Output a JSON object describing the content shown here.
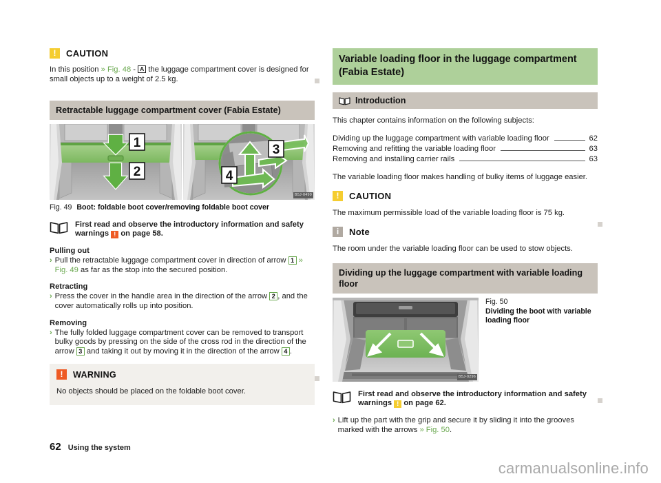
{
  "page": {
    "number": "62",
    "footer_section": "Using the system",
    "watermark": "carmanualsonline.info"
  },
  "left_column": {
    "caution_1": {
      "icon": "caution-icon",
      "title": "CAUTION",
      "text_part1": "In this position ",
      "link": "» Fig. 48",
      "text_part2": " - ",
      "ref": "A",
      "text_part3": " the luggage compartment cover is designed for small objects up to a weight of 2.5 kg."
    },
    "section_heading": "Retractable luggage compartment cover (Fabia Estate)",
    "figure": {
      "number": "Fig. 49",
      "caption": "Boot: foldable boot cover/removing foldable boot cover",
      "code": "B5J-0499",
      "callouts": [
        "1",
        "2",
        "3",
        "4"
      ]
    },
    "intro_note": {
      "icon": "book-icon",
      "text_part1": "First read and observe the introductory information and safety warnings ",
      "inline_icon": "!",
      "text_part2": " on page 58."
    },
    "pulling_out": {
      "heading": "Pulling out",
      "bullet_part1": "Pull the retractable luggage compartment cover in direction of arrow ",
      "ref": "1",
      "link": "» Fig. 49",
      "bullet_part2": " as far as the stop into the secured position."
    },
    "retracting": {
      "heading": "Retracting",
      "bullet_part1": "Press the cover in the handle area in the direction of the arrow ",
      "ref": "2",
      "bullet_part2": ", and the cover automatically rolls up into position."
    },
    "removing": {
      "heading": "Removing",
      "bullet_part1": "The fully folded luggage compartment cover can be removed to transport bulky goods by pressing on the side of the cross rod in the direction of the arrow ",
      "ref1": "3",
      "bullet_part2": " and taking it out by moving it in the direction of the arrow ",
      "ref2": "4",
      "bullet_part3": "."
    },
    "warning": {
      "icon": "warning-icon",
      "title": "WARNING",
      "text": "No objects should be placed on the foldable boot cover."
    }
  },
  "right_column": {
    "chapter_title": "Variable loading floor in the luggage compartment (Fabia Estate)",
    "introduction": {
      "icon": "book-icon",
      "heading": "Introduction",
      "lead": "This chapter contains information on the following subjects:",
      "toc": [
        {
          "label": "Dividing up the luggage compartment with variable loading floor",
          "page": "62"
        },
        {
          "label": "Removing and refitting the variable loading floor",
          "page": "63"
        },
        {
          "label": "Removing and installing carrier rails",
          "page": "63"
        }
      ],
      "body": "The variable loading floor makes handling of bulky items of luggage easier."
    },
    "caution": {
      "icon": "caution-icon",
      "title": "CAUTION",
      "text": "The maximum permissible load of the variable loading floor is 75 kg."
    },
    "note": {
      "icon": "note-icon",
      "title": "Note",
      "text": "The room under the variable loading floor can be used to stow objects."
    },
    "section_heading": "Dividing up the luggage compartment with variable loading floor",
    "figure": {
      "number": "Fig. 50",
      "caption": "Dividing the boot with variable loading floor",
      "code": "B5J-0296"
    },
    "intro_note": {
      "icon": "book-icon",
      "text_part1": "First read and observe the introductory information and safety warnings ",
      "inline_icon": "!",
      "text_part2": " on page 62."
    },
    "instruction": {
      "text_part1": "Lift up the part with the grip and secure it by sliding it into the grooves marked with the arrows ",
      "link": "» Fig. 50",
      "text_part2": "."
    }
  },
  "colors": {
    "chapter_banner": "#aed09a",
    "section_banner": "#c9c3bb",
    "caution_icon": "#f5cd30",
    "warning_icon": "#ee5a24",
    "note_icon": "#b0a9a1",
    "link_green": "#6aa84f",
    "warning_bg": "#f2f0ec"
  }
}
